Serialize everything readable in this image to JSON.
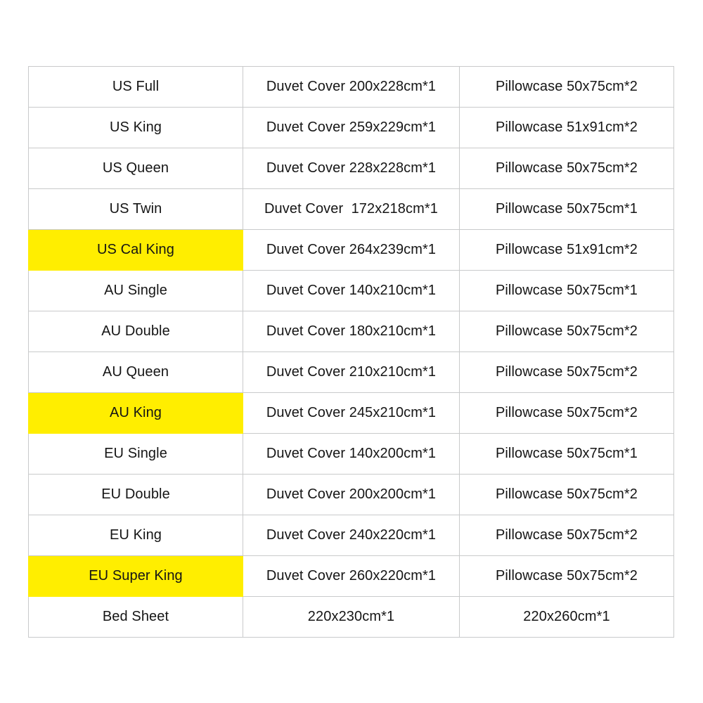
{
  "table": {
    "highlight_color": "#ffee00",
    "border_color": "#c9cacb",
    "text_color": "#151515",
    "background_color": "#ffffff",
    "columns": [
      "size_name",
      "duvet_cover",
      "pillowcase"
    ],
    "rows": [
      {
        "size_name": "US Full",
        "duvet_cover": "Duvet Cover 200x228cm*1",
        "pillowcase": "Pillowcase 50x75cm*2",
        "highlighted": false
      },
      {
        "size_name": "US King",
        "duvet_cover": "Duvet Cover 259x229cm*1",
        "pillowcase": "Pillowcase 51x91cm*2",
        "highlighted": false
      },
      {
        "size_name": "US Queen",
        "duvet_cover": "Duvet Cover 228x228cm*1",
        "pillowcase": "Pillowcase 50x75cm*2",
        "highlighted": false
      },
      {
        "size_name": "US Twin",
        "duvet_cover": "Duvet Cover  172x218cm*1",
        "pillowcase": "Pillowcase 50x75cm*1",
        "highlighted": false
      },
      {
        "size_name": "US Cal King",
        "duvet_cover": "Duvet Cover 264x239cm*1",
        "pillowcase": "Pillowcase 51x91cm*2",
        "highlighted": true
      },
      {
        "size_name": "AU Single",
        "duvet_cover": "Duvet Cover 140x210cm*1",
        "pillowcase": "Pillowcase 50x75cm*1",
        "highlighted": false
      },
      {
        "size_name": "AU Double",
        "duvet_cover": "Duvet Cover 180x210cm*1",
        "pillowcase": "Pillowcase 50x75cm*2",
        "highlighted": false
      },
      {
        "size_name": "AU Queen",
        "duvet_cover": "Duvet Cover 210x210cm*1",
        "pillowcase": "Pillowcase 50x75cm*2",
        "highlighted": false
      },
      {
        "size_name": "AU King",
        "duvet_cover": "Duvet Cover 245x210cm*1",
        "pillowcase": "Pillowcase 50x75cm*2",
        "highlighted": true
      },
      {
        "size_name": "EU Single",
        "duvet_cover": "Duvet Cover 140x200cm*1",
        "pillowcase": "Pillowcase 50x75cm*1",
        "highlighted": false
      },
      {
        "size_name": "EU Double",
        "duvet_cover": "Duvet Cover 200x200cm*1",
        "pillowcase": "Pillowcase 50x75cm*2",
        "highlighted": false
      },
      {
        "size_name": "EU King",
        "duvet_cover": "Duvet Cover 240x220cm*1",
        "pillowcase": "Pillowcase 50x75cm*2",
        "highlighted": false
      },
      {
        "size_name": "EU Super King",
        "duvet_cover": "Duvet Cover 260x220cm*1",
        "pillowcase": "Pillowcase 50x75cm*2",
        "highlighted": true
      },
      {
        "size_name": "Bed Sheet",
        "duvet_cover": "220x230cm*1",
        "pillowcase": "220x260cm*1",
        "highlighted": false
      }
    ]
  }
}
